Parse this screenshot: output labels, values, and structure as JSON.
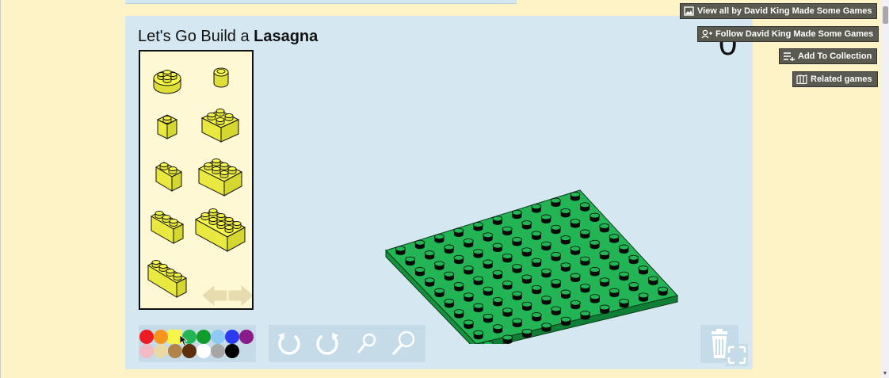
{
  "game": {
    "title_prefix": "Let's Go Build a ",
    "title_bold": "Lasagna",
    "score": "0"
  },
  "side_buttons": {
    "view_all": "View all by David King Made Some Games",
    "follow": "Follow David King Made Some Games",
    "add_collection": "Add To Collection",
    "related": "Related games"
  },
  "colors": {
    "background": "#fef3c7",
    "game_bg": "#d5e8f1",
    "board_green": "#22b455",
    "selected_brick": "#f5f54a"
  },
  "palette_pieces": [
    "round-brick-2x2",
    "round-brick-1x1",
    "brick-1x1",
    "brick-2x2",
    "brick-1x2",
    "brick-2x3",
    "brick-1x3",
    "brick-2x4",
    "brick-1x4"
  ],
  "color_swatches": [
    "#ed1c24",
    "#f7941d",
    "#f5f54a",
    "#22b455",
    "#119d2a",
    "#8ec8f5",
    "#2b3cf0",
    "#8b1a8b",
    "#f3b9c4",
    "#e9d9a7",
    "#b0844a",
    "#5c2e0a",
    "#ffffff",
    "#a6a6a6",
    "#000000"
  ],
  "tools": [
    "rotate-left-icon",
    "rotate-right-icon",
    "zoom-out-icon",
    "zoom-in-icon"
  ]
}
